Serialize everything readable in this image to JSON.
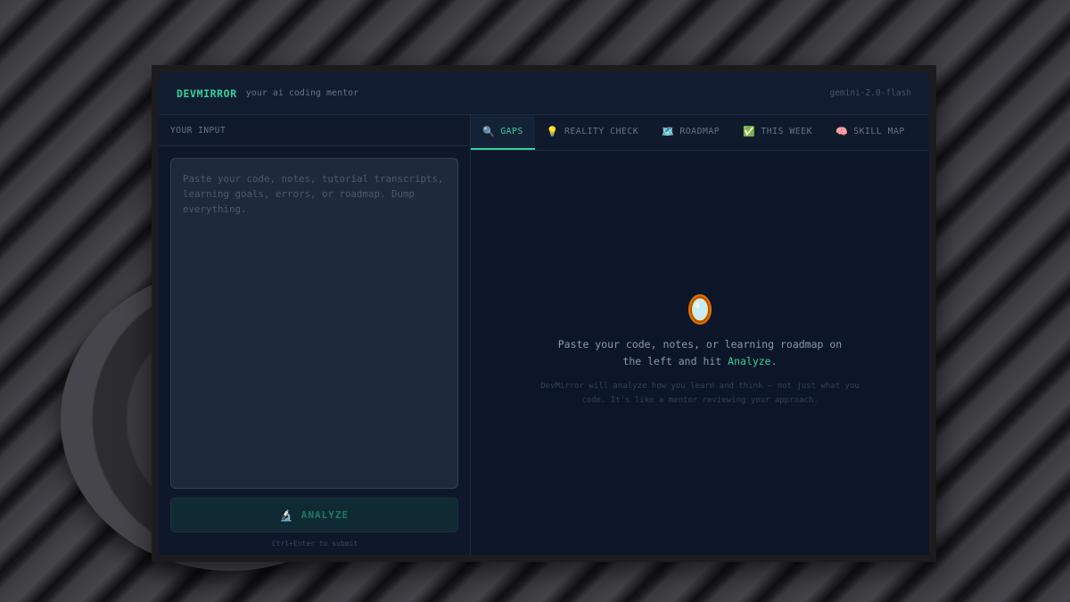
{
  "app": {
    "brand": "DEVMIRROR",
    "tagline": "your ai coding mentor",
    "model": "gemini-2.0-flash"
  },
  "input_panel": {
    "header": "YOUR INPUT",
    "placeholder": "Paste your code, notes, tutorial transcripts, learning goals, errors, or roadmap. Dump everything.",
    "value": "",
    "analyze_label": "ANALYZE",
    "analyze_icon": "microscope-icon",
    "hint": "Ctrl+Enter to submit"
  },
  "tabs": [
    {
      "label": "GAPS",
      "icon": "magnifier-icon",
      "glyph": "🔍",
      "active": true
    },
    {
      "label": "REALITY CHECK",
      "icon": "lightbulb-icon",
      "glyph": "💡",
      "active": false
    },
    {
      "label": "ROADMAP",
      "icon": "map-icon",
      "glyph": "🗺️",
      "active": false
    },
    {
      "label": "THIS WEEK",
      "icon": "check-icon",
      "glyph": "✅",
      "active": false
    },
    {
      "label": "SKILL MAP",
      "icon": "brain-icon",
      "glyph": "🧠",
      "active": false
    }
  ],
  "empty_state": {
    "icon": "mirror-icon",
    "main_before": "Paste your code, notes, or learning roadmap on the left and hit ",
    "main_highlight": "Analyze",
    "main_after": ".",
    "sub": "DevMirror will analyze how you learn and think — not just what you code. It's like a mentor reviewing your approach."
  },
  "colors": {
    "accent": "#34d399",
    "panel_bg": "#0f172a",
    "input_bg": "#1e293b"
  }
}
